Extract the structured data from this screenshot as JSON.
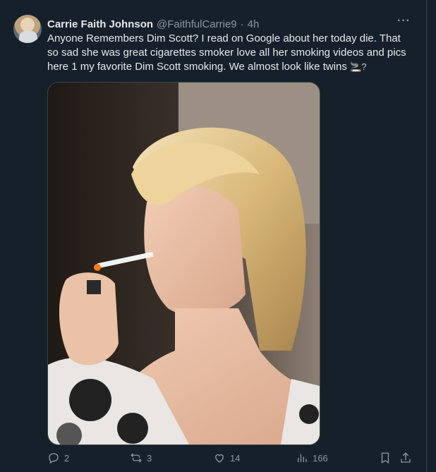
{
  "tweet": {
    "author_name": "Carrie Faith Johnson",
    "author_handle": "@FaithfulCarrie9",
    "separator": "·",
    "time": "4h",
    "more_label": "···",
    "text": "Anyone Remembers Dim Scott? I read on Google about her today die. That so sad she was great cigarettes smoker love all her smoking videos and pics here 1 my favorite Dim Scott smoking. We almost look like twins ",
    "emoji": "🚬?"
  },
  "actions": {
    "replies": "2",
    "reposts": "3",
    "likes": "14",
    "views": "166"
  },
  "icons": {
    "reply": "reply-icon",
    "repost": "repost-icon",
    "like": "heart-icon",
    "views": "views-icon",
    "bookmark": "bookmark-icon",
    "share": "share-icon"
  },
  "colors": {
    "background": "#15202b",
    "text": "#e7e9ea",
    "muted": "#8b98a5"
  }
}
